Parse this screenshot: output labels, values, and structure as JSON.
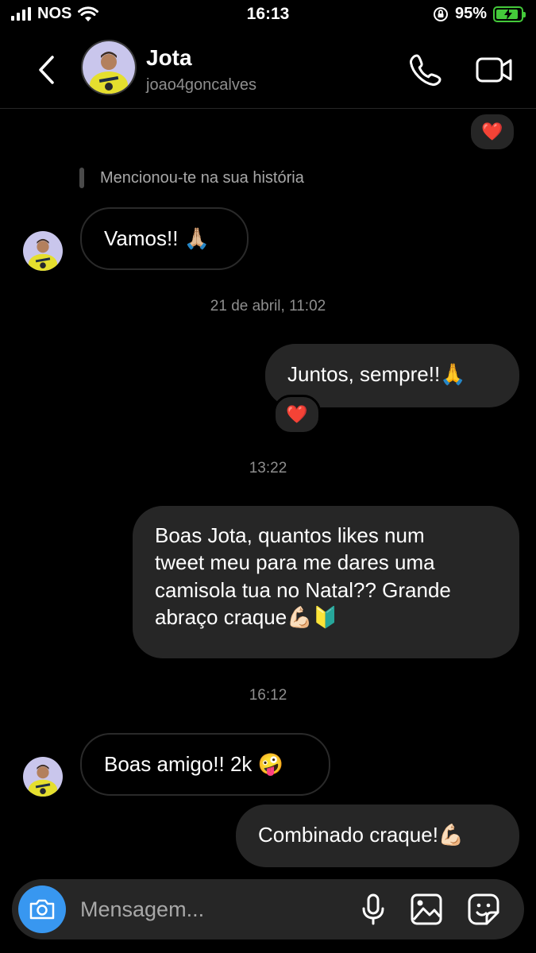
{
  "status_bar": {
    "carrier": "NOS",
    "time": "16:13",
    "battery_percent": "95%",
    "battery_level": 0.95,
    "signal_icon": "signal-bars-icon",
    "wifi_icon": "wifi-icon",
    "lock_icon": "orientation-lock-icon",
    "battery_icon": "battery-charging-icon",
    "battery_color": "#44c93a"
  },
  "header": {
    "name": "Jota",
    "username": "joao4goncalves",
    "back_icon": "back-chevron-icon",
    "call_icon": "phone-icon",
    "video_icon": "video-camera-icon"
  },
  "thread": {
    "top_reaction": "❤️",
    "story_mention": "Mencionou-te na sua história",
    "msg_vamos": "Vamos!! 🙏🏼",
    "time_1": "21 de abril, 11:02",
    "msg_juntos": "Juntos, sempre!!🙏",
    "reaction_juntos": "❤️",
    "time_2": "13:22",
    "msg_boas_jota": "Boas Jota, quantos likes num\ntweet meu para me dares uma\ncamisola tua no Natal??  Grande\nabraço craque💪🏻🔰",
    "time_3": "16:12",
    "msg_boas_amigo": "Boas amigo!! 2k 🤪",
    "msg_combinado": "Combinado craque!💪🏻"
  },
  "composer": {
    "placeholder": "Mensagem...",
    "camera_icon": "camera-icon",
    "mic_icon": "microphone-icon",
    "gallery_icon": "gallery-icon",
    "sticker_icon": "sticker-icon",
    "camera_color": "#3897f0"
  }
}
